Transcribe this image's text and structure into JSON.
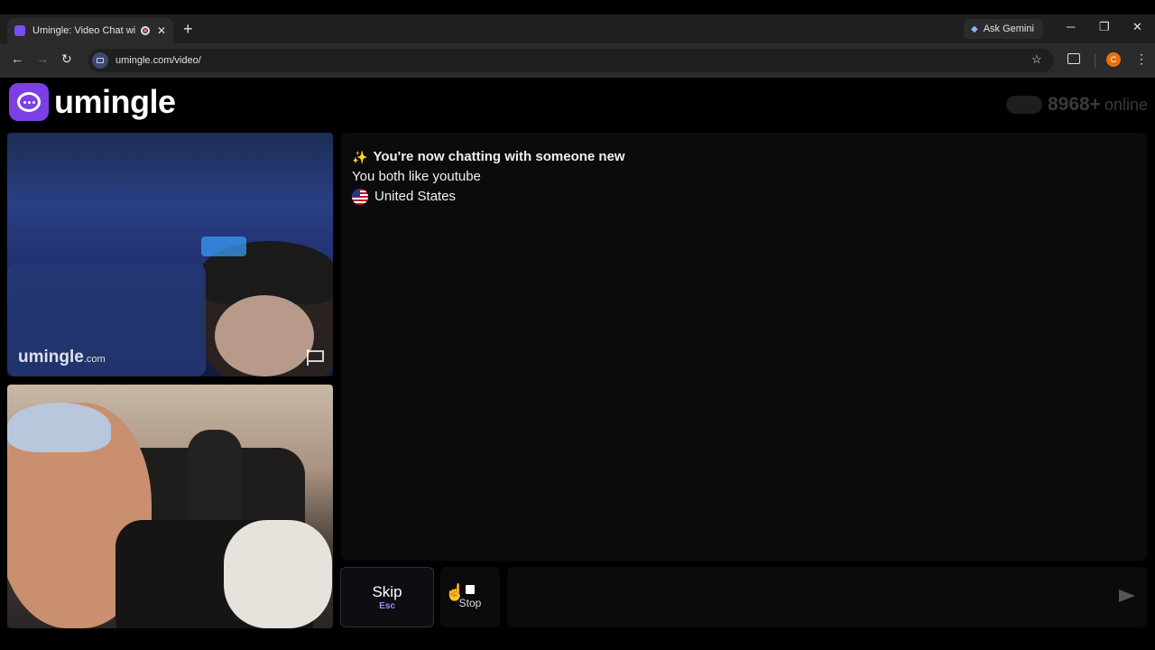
{
  "browser": {
    "tab_title": "Umingle: Video Chat with S",
    "tab_close": "✕",
    "new_tab": "+",
    "ask_gemini": "Ask Gemini",
    "url": "umingle.com/video/",
    "profile_initial": "C",
    "window_controls": {
      "minimize": "─",
      "restore": "❐",
      "close": "✕"
    },
    "nav": {
      "back": "←",
      "forward": "→",
      "reload": "↻",
      "menu": "⋮",
      "bookmark": "☆"
    }
  },
  "site": {
    "logo_text": "umingle",
    "online_count": "8968+",
    "online_label": "online",
    "watermark_main": "umingle",
    "watermark_suffix": ".com"
  },
  "chat": {
    "messages": [
      {
        "icon": "sparkle",
        "text": "You're now chatting with someone new"
      },
      {
        "icon": null,
        "text": "You both like youtube"
      },
      {
        "icon": "us-flag",
        "text": "United States"
      }
    ],
    "input_placeholder": ""
  },
  "controls": {
    "skip_label": "Skip",
    "skip_hint": "Esc",
    "stop_label": "Stop"
  },
  "colors": {
    "brand": "#7b3fe4",
    "skip_hint": "#a688ff",
    "chat_bg": "#0b0b0b"
  },
  "icons": [
    "chat-bubble-icon",
    "report-flag-icon",
    "sparkle-icon",
    "us-flag-icon",
    "stop-icon",
    "send-icon"
  ]
}
